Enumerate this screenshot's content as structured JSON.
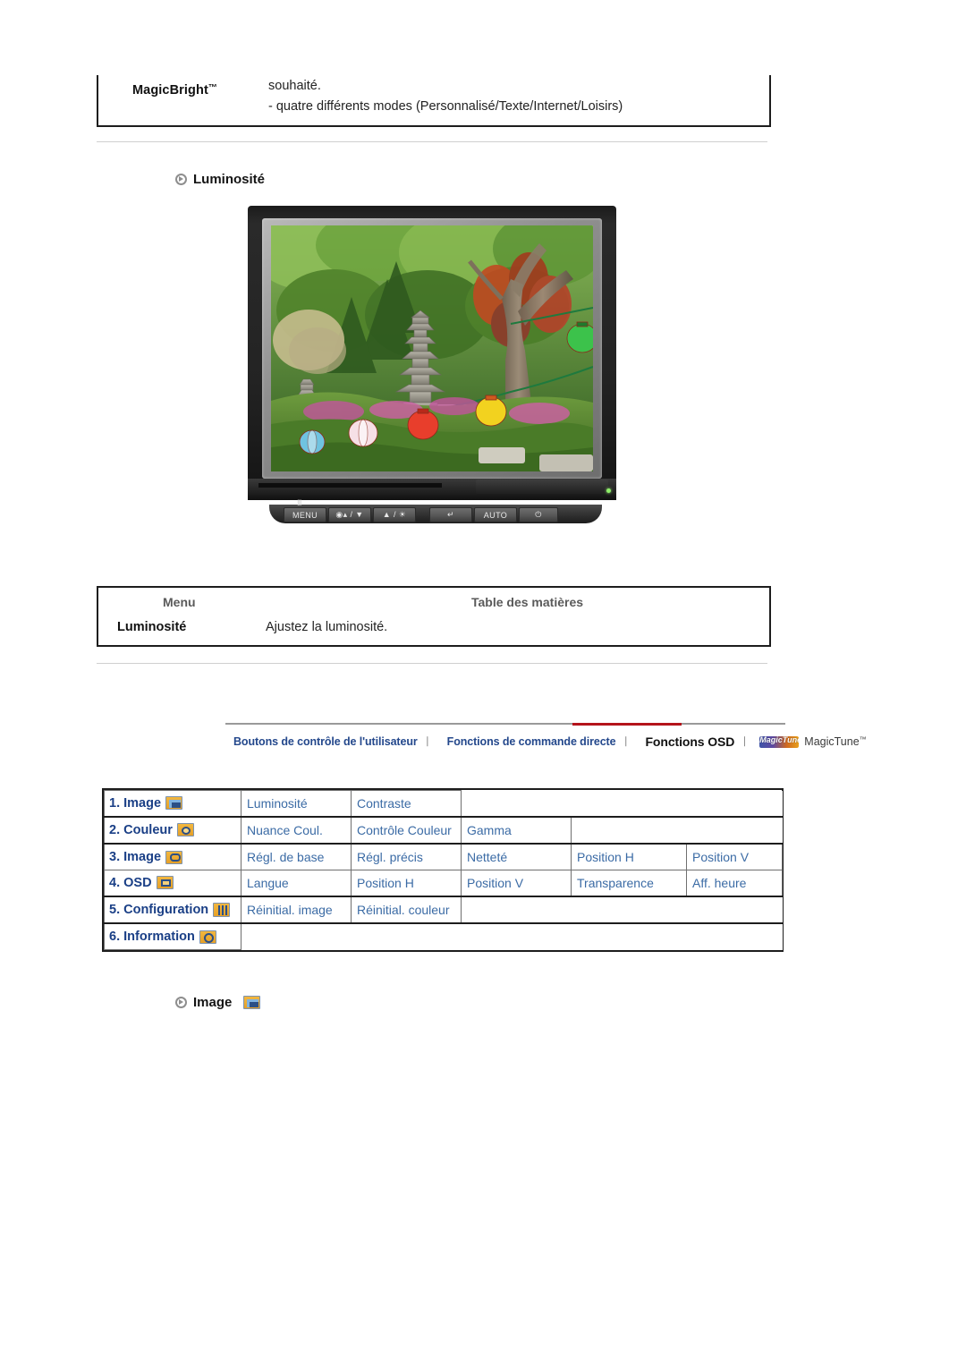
{
  "magicbright_box": {
    "label": "MagicBright",
    "tm": "™",
    "line1": "souhaité.",
    "line2": "- quatre différents modes (Personnalisé/Texte/Internet/Loisirs)"
  },
  "section_luminosite": {
    "heading": "Luminosité"
  },
  "monitor": {
    "buttons": [
      {
        "name": "menu-button",
        "label": "MENU"
      },
      {
        "name": "down-brightness-button",
        "label": "◉▴ / ▼"
      },
      {
        "name": "up-brightness-button",
        "label": "▲ / ☀"
      },
      {
        "name": "source-button",
        "label": "↵"
      },
      {
        "name": "auto-button",
        "label": "AUTO"
      },
      {
        "name": "power-button",
        "label": "⏻"
      }
    ],
    "menu_glyph": "III"
  },
  "menu_table": {
    "header_menu": "Menu",
    "header_toc": "Table des matières",
    "row_label": "Luminosité",
    "row_desc": "Ajustez la luminosité."
  },
  "navbar": {
    "items": [
      {
        "label": "Boutons de contrôle de l'utilisateur",
        "active": false
      },
      {
        "label": "Fonctions de commande directe",
        "active": false
      },
      {
        "label": "Fonctions OSD",
        "active": true
      }
    ],
    "separator": "⎸",
    "magictune_logo_text": "MagicTune",
    "magictune_name": "MagicTune",
    "magictune_tm": "™",
    "active_accent_color": "#b4131b",
    "link_color": "#24488c"
  },
  "osd_table": {
    "rows": [
      {
        "category": "1. Image",
        "icon": "picture-icon",
        "items": [
          "Luminosité",
          "Contraste"
        ]
      },
      {
        "category": "2. Couleur",
        "icon": "color-wheel-icon",
        "items": [
          "Nuance Coul.",
          "Contrôle Couleur",
          "Gamma"
        ]
      },
      {
        "category": "3. Image",
        "icon": "image-position-icon",
        "items": [
          "Régl. de base",
          "Régl. précis",
          "Netteté",
          "Position H",
          "Position V"
        ]
      },
      {
        "category": "4. OSD",
        "icon": "osd-window-icon",
        "items": [
          "Langue",
          "Position H",
          "Position V",
          "Transparence",
          "Aff. heure"
        ]
      },
      {
        "category": "5. Configuration",
        "icon": "setup-sliders-icon",
        "items": [
          "Réinitial. image",
          "Réinitial. couleur"
        ]
      },
      {
        "category": "6. Information",
        "icon": "info-clock-icon",
        "items": []
      }
    ],
    "text_color": "#3b6ba5",
    "category_color": "#1a3f86"
  },
  "section_image": {
    "heading": "Image",
    "icon": "picture-icon"
  }
}
